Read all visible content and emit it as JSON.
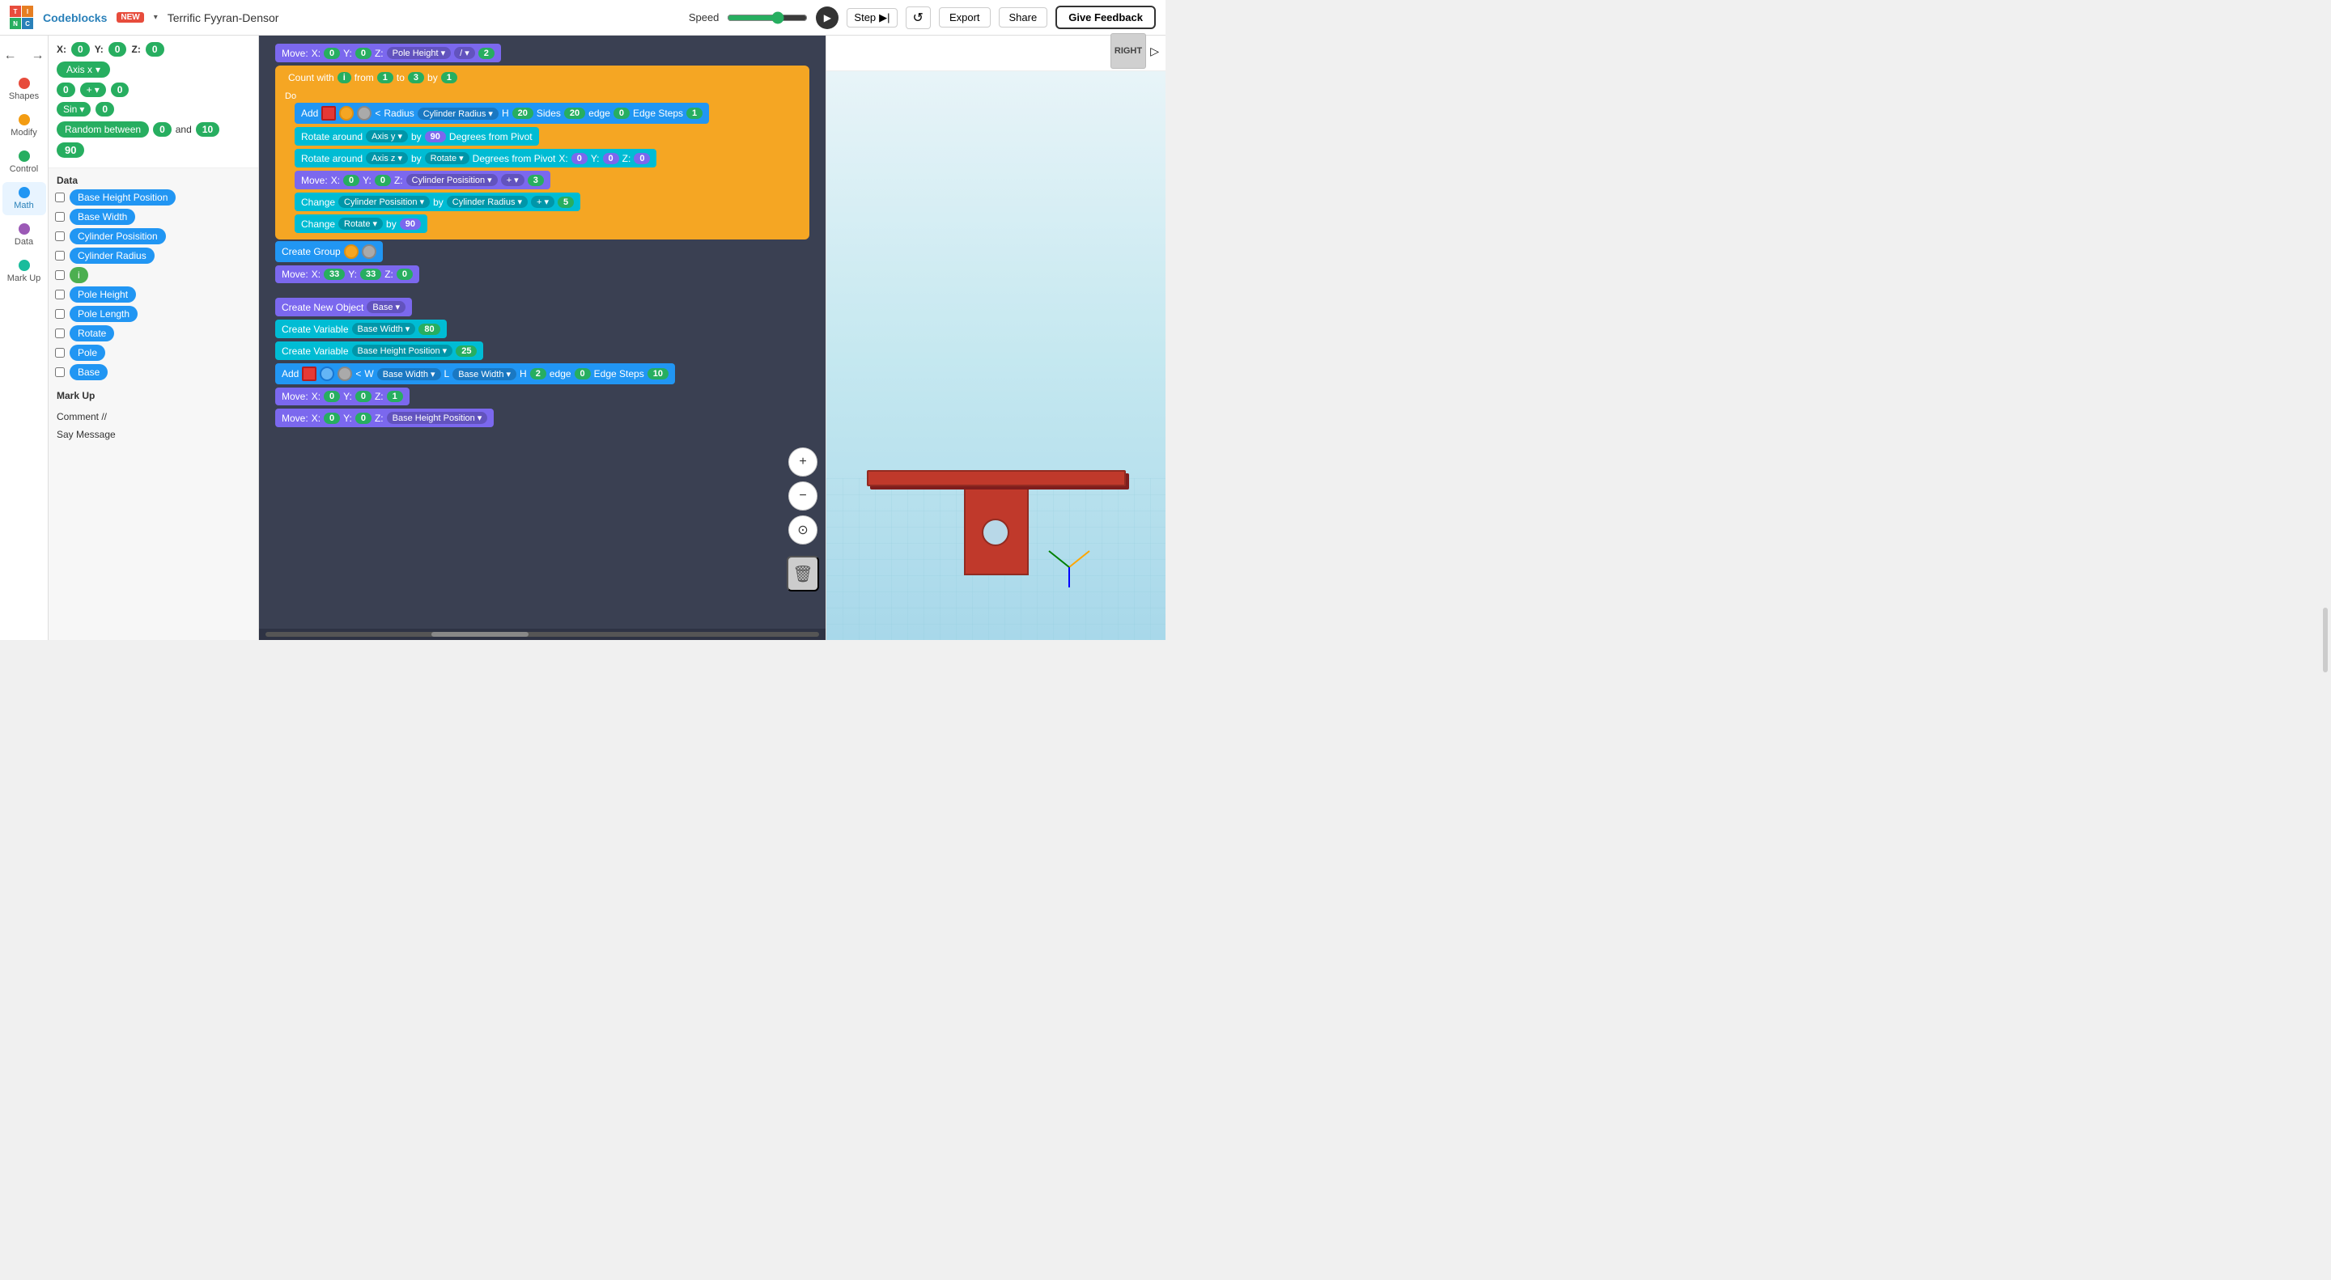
{
  "topbar": {
    "logo_tiles": [
      "T",
      "I",
      "N",
      "C"
    ],
    "brand": "Codeblocks",
    "new_label": "NEW",
    "project_name": "Terrific Fyyran-Densor",
    "speed_label": "Speed",
    "step_label": "Step",
    "export_label": "Export",
    "share_label": "Share",
    "give_feedback_label": "Give Feedback"
  },
  "sidebar": {
    "items": [
      {
        "id": "shapes",
        "label": "Shapes",
        "color": "#e74c3c"
      },
      {
        "id": "modify",
        "label": "Modify",
        "color": "#f39c12"
      },
      {
        "id": "control",
        "label": "Control",
        "color": "#27ae60"
      },
      {
        "id": "math",
        "label": "Math",
        "color": "#2196f3",
        "active": true
      },
      {
        "id": "data",
        "label": "Data",
        "color": "#9b59b6"
      },
      {
        "id": "markup",
        "label": "Mark Up",
        "color": "#1abc9c"
      }
    ]
  },
  "blocks_panel": {
    "xyz": {
      "x": "0",
      "y": "0",
      "z": "0"
    },
    "axis": "Axis x",
    "math_ops": {
      "op": "+",
      "val": "0"
    },
    "sin_val": "0",
    "random": {
      "label": "Random between",
      "from": "0",
      "to": "10"
    },
    "val_90": "90",
    "data_section": "Data",
    "data_items": [
      "Base Height Position",
      "Base Width",
      "Cylinder Posisition",
      "Cylinder Radius",
      "i",
      "Pole Height",
      "Pole Length",
      "Rotate",
      "Pole",
      "Base"
    ],
    "markup_section": "Mark Up",
    "markup_items": [
      "Comment //",
      "Say  Message"
    ]
  },
  "canvas": {
    "blocks": [
      {
        "type": "move",
        "label": "Move:",
        "x": "0",
        "y": "0",
        "z": "Pole Height",
        "op": "/",
        "val": "2"
      },
      {
        "type": "count_with",
        "label": "Count with",
        "var": "i",
        "from": "1",
        "to": "3",
        "by": "1"
      },
      {
        "type": "add",
        "shapes": [
          "orange",
          "gray"
        ],
        "radius_label": "Radius",
        "radius_val": "Cylinder Radius",
        "h_label": "H",
        "h_val": "20",
        "sides_label": "Sides",
        "sides_val": "20",
        "edge_label": "edge",
        "edge_val": "0",
        "steps_label": "Edge Steps",
        "steps_val": "1"
      },
      {
        "type": "rotate_y",
        "label": "Rotate around",
        "axis": "Axis y",
        "by": "90",
        "degrees": "Degrees from Pivot"
      },
      {
        "type": "rotate_z",
        "label": "Rotate around",
        "axis": "Axis z",
        "by": "Rotate",
        "degrees": "Degrees from Pivot",
        "x": "0",
        "y": "0",
        "z": "0"
      },
      {
        "type": "move2",
        "label": "Move:",
        "x": "0",
        "y": "0",
        "z": "Cylinder Posisition",
        "op": "+",
        "val": "3"
      },
      {
        "type": "change_pos",
        "label": "Change",
        "var": "Cylinder Posisition",
        "by_label": "by",
        "change_var": "Cylinder Radius",
        "op": "+",
        "val": "5"
      },
      {
        "type": "change_rot",
        "label": "Change",
        "var": "Rotate",
        "by_label": "by",
        "val": "90"
      }
    ],
    "create_group": {
      "label": "Create Group",
      "shapes": [
        "orange",
        "gray"
      ]
    },
    "move_group": {
      "label": "Move:",
      "x": "33",
      "y": "33",
      "z": "0"
    },
    "create_obj": {
      "label": "Create New Object",
      "base": "Base"
    },
    "create_vars": [
      {
        "label": "Create Variable",
        "name": "Base Width",
        "val": "80"
      },
      {
        "label": "Create Variable",
        "name": "Base Height Position",
        "val": "25"
      }
    ],
    "add_base": {
      "shape1": "red",
      "shape2": "blue_circle",
      "shape3": "gray",
      "w_label": "W",
      "w_var": "Base Width",
      "l_label": "L",
      "l_var": "Base Width",
      "h_label": "H",
      "h_val": "2",
      "edge_label": "edge",
      "edge_val": "0",
      "steps_label": "Edge Steps",
      "steps_val": "10"
    },
    "move_base1": {
      "label": "Move:",
      "x": "0",
      "y": "0",
      "z": "1"
    },
    "move_base2": {
      "label": "Move:",
      "x": "0",
      "y": "0",
      "z": "Base Height Position"
    }
  },
  "viewport": {
    "view_cube_label": "RIGHT",
    "zoom_in": "+",
    "zoom_out": "−",
    "reset_view": "⊙"
  }
}
